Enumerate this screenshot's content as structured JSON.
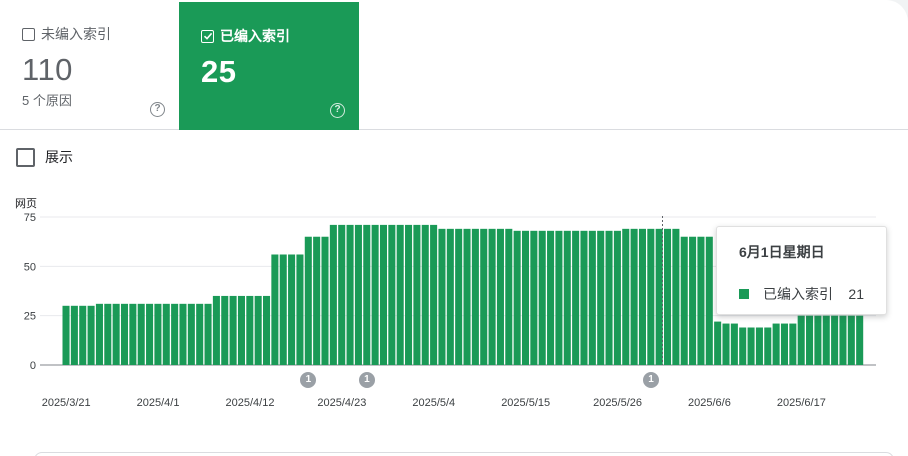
{
  "cards": {
    "not_indexed": {
      "label": "未编入索引",
      "count": "110",
      "sub": "5 个原因",
      "help": "?"
    },
    "indexed": {
      "label": "已编入索引",
      "count": "25",
      "help": "?"
    }
  },
  "show_toggle": {
    "label": "展示"
  },
  "colors": {
    "accent": "#1a9a57",
    "grid": "#e8eaed",
    "marker": "#9aa0a6"
  },
  "chart_data": {
    "type": "bar",
    "ylabel": "网页",
    "ylim": [
      0,
      75
    ],
    "yticks": [
      "0",
      "25",
      "50",
      "75"
    ],
    "xticks": [
      "2025/3/21",
      "2025/4/1",
      "2025/4/12",
      "2025/4/23",
      "2025/5/4",
      "2025/5/15",
      "2025/5/26",
      "2025/6/6",
      "2025/6/17"
    ],
    "start_date": "2025-03-21",
    "values": [
      30,
      30,
      30,
      30,
      31,
      31,
      31,
      31,
      31,
      31,
      31,
      31,
      31,
      31,
      31,
      31,
      31,
      31,
      35,
      35,
      35,
      35,
      35,
      35,
      35,
      56,
      56,
      56,
      56,
      65,
      65,
      65,
      71,
      71,
      71,
      71,
      71,
      71,
      71,
      71,
      71,
      71,
      71,
      71,
      71,
      69,
      69,
      69,
      69,
      69,
      69,
      69,
      69,
      69,
      68,
      68,
      68,
      68,
      68,
      68,
      68,
      68,
      68,
      68,
      68,
      68,
      68,
      69,
      69,
      69,
      69,
      69,
      69,
      69,
      65,
      65,
      65,
      65,
      22,
      21,
      21,
      19,
      19,
      19,
      19,
      21,
      21,
      21,
      25,
      25,
      25,
      25,
      25,
      25,
      25,
      25
    ],
    "annotations": [
      {
        "date": "2025/4/19",
        "label": "1"
      },
      {
        "date": "2025/4/26",
        "label": "1"
      },
      {
        "date": "2025/5/30",
        "label": "1"
      }
    ]
  },
  "tooltip": {
    "date": "6月1日星期日",
    "series": "已编入索引",
    "value": "21"
  }
}
